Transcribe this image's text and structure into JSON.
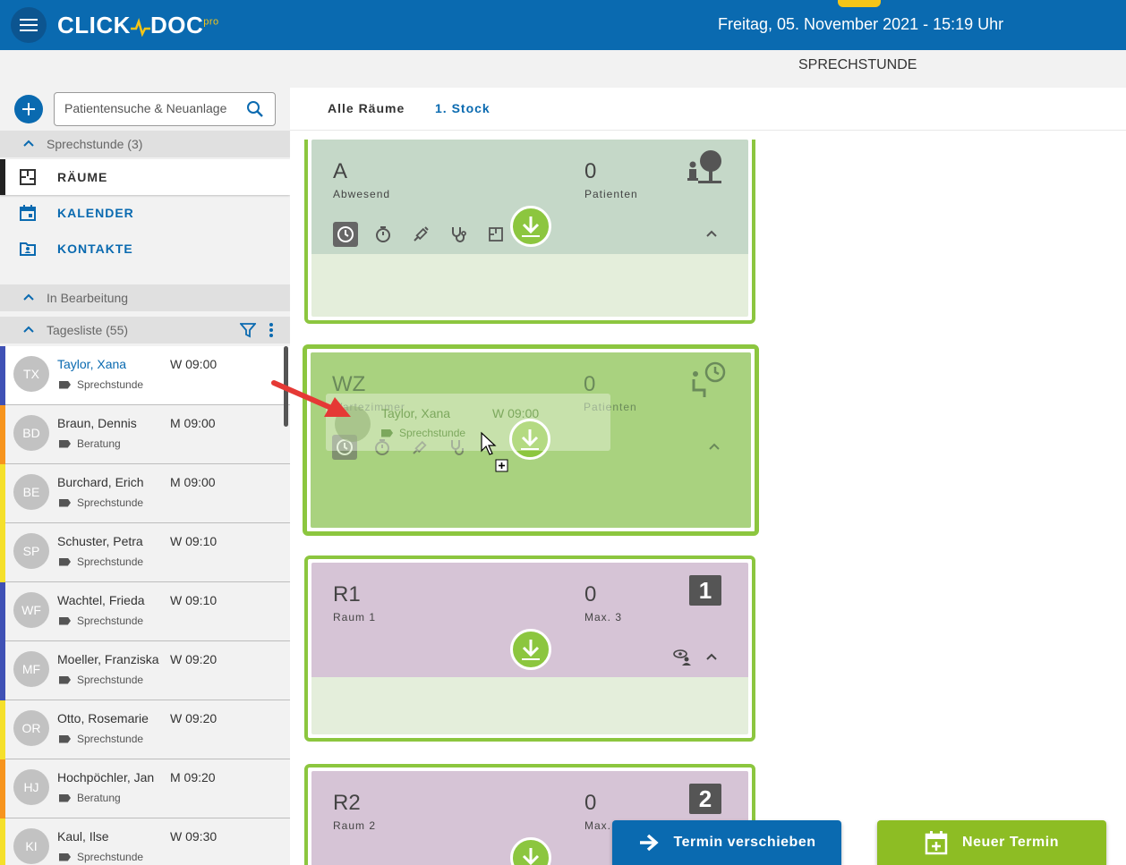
{
  "header": {
    "brand": "CLICK",
    "brand2": "DOC",
    "brand_sup": "pro",
    "datetime": "Freitag, 05. November 2021 - 15:19 Uhr",
    "page_title": "SPRECHSTUNDE"
  },
  "search": {
    "placeholder": "Patientensuche & Neuanlage"
  },
  "sidebar": {
    "section_sprechstunde": "Sprechstunde (3)",
    "nav": [
      {
        "label": "RÄUME",
        "icon": "floorplan-icon"
      },
      {
        "label": "KALENDER",
        "icon": "calendar-icon"
      },
      {
        "label": "KONTAKTE",
        "icon": "contacts-icon"
      }
    ],
    "section_bearbeitung": "In Bearbeitung",
    "section_tagesliste": "Tagesliste (55)"
  },
  "patients": [
    {
      "initials": "TX",
      "name": "Taylor, Xana",
      "time": "W 09:00",
      "tag": "Sprechstunde",
      "color": "#3f51b5"
    },
    {
      "initials": "BD",
      "name": "Braun, Dennis",
      "time": "M 09:00",
      "tag": "Beratung",
      "color": "#f7941d"
    },
    {
      "initials": "BE",
      "name": "Burchard, Erich",
      "time": "M 09:00",
      "tag": "Sprechstunde",
      "color": "#f5e02b"
    },
    {
      "initials": "SP",
      "name": "Schuster, Petra",
      "time": "W 09:10",
      "tag": "Sprechstunde",
      "color": "#f5e02b"
    },
    {
      "initials": "WF",
      "name": "Wachtel, Frieda",
      "time": "W 09:10",
      "tag": "Sprechstunde",
      "color": "#3f51b5"
    },
    {
      "initials": "MF",
      "name": "Moeller, Franziska",
      "time": "W 09:20",
      "tag": "Sprechstunde",
      "color": "#3f51b5"
    },
    {
      "initials": "OR",
      "name": "Otto, Rosemarie",
      "time": "W 09:20",
      "tag": "Sprechstunde",
      "color": "#f5e02b"
    },
    {
      "initials": "HJ",
      "name": "Hochpöchler, Jan",
      "time": "M 09:20",
      "tag": "Beratung",
      "color": "#f7941d"
    },
    {
      "initials": "KI",
      "name": "Kaul, Ilse",
      "time": "W 09:30",
      "tag": "Sprechstunde",
      "color": "#f5e02b"
    }
  ],
  "tabs": [
    "Alle Räume",
    "1. Stock"
  ],
  "rooms": [
    {
      "code": "A",
      "name": "Abwesend",
      "count": "0",
      "count_label": "Patienten",
      "head_color": "#c5d8c8"
    },
    {
      "code": "WZ",
      "name": "Wartezimmer",
      "count": "0",
      "count_label": "Patienten",
      "head_color": "#a9d27f"
    },
    {
      "code": "R1",
      "name": "Raum 1",
      "count": "0",
      "count_label": "Max. 3",
      "badge": "1",
      "head_color": "#d6c4d6"
    },
    {
      "code": "R2",
      "name": "Raum 2",
      "count": "0",
      "count_label": "Max.",
      "badge": "2",
      "head_color": "#d6c4d6"
    }
  ],
  "drag_ghost": {
    "name": "Taylor, Xana",
    "time": "W 09:00",
    "tag": "Sprechstunde"
  },
  "buttons": {
    "move": "Termin verschieben",
    "new": "Neuer Termin"
  },
  "colors": {
    "primary": "#0a6ab0",
    "green": "#8cc63f",
    "new_button": "#8dbd24"
  }
}
